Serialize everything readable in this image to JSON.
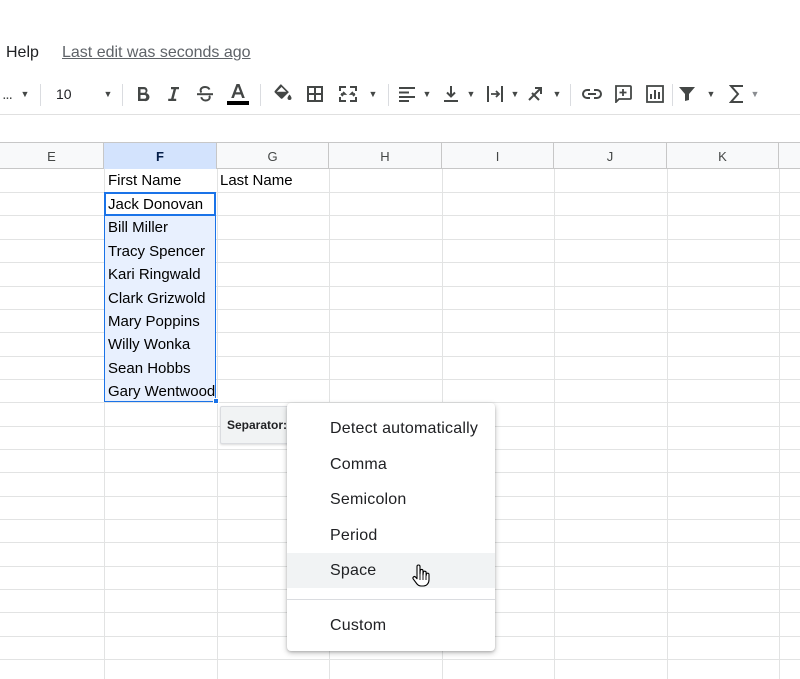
{
  "menu": {
    "help": "Help",
    "last_edit": "Last edit was seconds ago"
  },
  "toolbar": {
    "font_name": "...",
    "font_size": "10",
    "icons": [
      "bold-icon",
      "italic-icon",
      "strikethrough-icon",
      "text-color-icon",
      "fill-color-icon",
      "borders-icon",
      "merge-cells-icon",
      "horizontal-align-icon",
      "vertical-align-icon",
      "text-wrapping-icon",
      "text-rotation-icon",
      "insert-link-icon",
      "insert-comment-icon",
      "insert-chart-icon",
      "filter-icon",
      "functions-icon"
    ],
    "text_color_underline": "#000000"
  },
  "columns": [
    "E",
    "F",
    "G",
    "H",
    "I",
    "J",
    "K"
  ],
  "selected_column": "F",
  "cells": {
    "header_f": "First Name",
    "header_g": "Last Name",
    "names": [
      "Jack Donovan",
      "Bill Miller",
      "Tracy Spencer",
      "Kari Ringwald",
      "Clark Grizwold",
      "Mary Poppins",
      "Willy Wonka",
      "Sean Hobbs",
      "Gary Wentwood"
    ]
  },
  "separator": {
    "label": "Separator:"
  },
  "separator_menu": {
    "options": [
      "Detect automatically",
      "Comma",
      "Semicolon",
      "Period",
      "Space"
    ],
    "custom": "Custom",
    "hovered": "Space"
  },
  "colors": {
    "selection_border": "#1a73e8",
    "selection_fill": "#e8f0fe",
    "header_selected": "#d3e3fd"
  }
}
